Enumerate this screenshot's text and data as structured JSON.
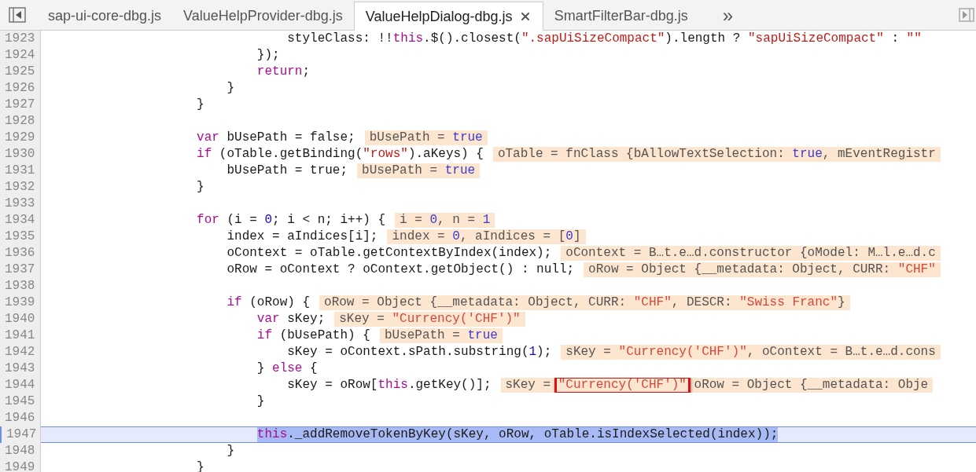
{
  "tabs": [
    {
      "label": "sap-ui-core-dbg.js",
      "selected": false
    },
    {
      "label": "ValueHelpProvider-dbg.js",
      "selected": false
    },
    {
      "label": "ValueHelpDialog-dbg.js",
      "selected": true
    },
    {
      "label": "SmartFilterBar-dbg.js",
      "selected": false
    }
  ],
  "more_tabs": "»",
  "lines": [
    {
      "n": "1923",
      "code": [
        {
          "t": "                                styleClass: !!",
          "kind": "plain"
        },
        {
          "t": "this",
          "kind": "keyword"
        },
        {
          "t": ".$().closest(",
          "kind": "plain"
        },
        {
          "t": "\".sapUiSizeCompact\"",
          "kind": "string"
        },
        {
          "t": ").length ? ",
          "kind": "plain"
        },
        {
          "t": "\"sapUiSizeCompact\"",
          "kind": "string"
        },
        {
          "t": " : ",
          "kind": "plain"
        },
        {
          "t": "\"\"",
          "kind": "string"
        }
      ]
    },
    {
      "n": "1924",
      "code": [
        {
          "t": "                            });",
          "kind": "plain"
        }
      ]
    },
    {
      "n": "1925",
      "code": [
        {
          "t": "                            return",
          "kind": "keyword"
        },
        {
          "t": ";",
          "kind": "plain"
        }
      ]
    },
    {
      "n": "1926",
      "code": [
        {
          "t": "                        }",
          "kind": "plain"
        }
      ]
    },
    {
      "n": "1927",
      "code": [
        {
          "t": "                    }",
          "kind": "plain"
        }
      ]
    },
    {
      "n": "1928"
    },
    {
      "n": "1929",
      "code": [
        {
          "t": "                    var",
          "kind": "keyword"
        },
        {
          "t": " bUsePath = false;",
          "kind": "plain"
        }
      ],
      "value": [
        {
          "t": "bUsePath = ",
          "kind": "plain"
        },
        {
          "t": "true",
          "kind": "literal"
        }
      ]
    },
    {
      "n": "1930",
      "code": [
        {
          "t": "                    if",
          "kind": "keyword"
        },
        {
          "t": " (oTable.getBinding(",
          "kind": "plain"
        },
        {
          "t": "\"rows\"",
          "kind": "string"
        },
        {
          "t": ").aKeys) {",
          "kind": "plain"
        }
      ],
      "value": [
        {
          "t": "oTable = fnClass {bAllowTextSelection: ",
          "kind": "plain"
        },
        {
          "t": "true",
          "kind": "literal"
        },
        {
          "t": ", mEventRegistr",
          "kind": "plain"
        }
      ]
    },
    {
      "n": "1931",
      "code": [
        {
          "t": "                        bUsePath = true;",
          "kind": "plain"
        }
      ],
      "value": [
        {
          "t": "bUsePath = ",
          "kind": "plain"
        },
        {
          "t": "true",
          "kind": "literal"
        }
      ]
    },
    {
      "n": "1932",
      "code": [
        {
          "t": "                    }",
          "kind": "plain"
        }
      ]
    },
    {
      "n": "1933"
    },
    {
      "n": "1934",
      "code": [
        {
          "t": "                    for",
          "kind": "keyword"
        },
        {
          "t": " (i = ",
          "kind": "plain"
        },
        {
          "t": "0",
          "kind": "literal"
        },
        {
          "t": "; i < n; i++) {",
          "kind": "plain"
        }
      ],
      "value": [
        {
          "t": "i = ",
          "kind": "plain"
        },
        {
          "t": "0",
          "kind": "literal"
        },
        {
          "t": ", n = ",
          "kind": "plain"
        },
        {
          "t": "1",
          "kind": "literal"
        }
      ]
    },
    {
      "n": "1935",
      "code": [
        {
          "t": "                        index = aIndices[i];",
          "kind": "plain"
        }
      ],
      "value": [
        {
          "t": "index = ",
          "kind": "plain"
        },
        {
          "t": "0",
          "kind": "literal"
        },
        {
          "t": ", aIndices = [",
          "kind": "plain"
        },
        {
          "t": "0",
          "kind": "literal"
        },
        {
          "t": "]",
          "kind": "plain"
        }
      ]
    },
    {
      "n": "1936",
      "code": [
        {
          "t": "                        oContext = oTable.getContextByIndex(index);",
          "kind": "plain"
        }
      ],
      "value": [
        {
          "t": "oContext = B…t.e…d.constructor {oModel: M…l.e…d.c",
          "kind": "plain"
        }
      ]
    },
    {
      "n": "1937",
      "code": [
        {
          "t": "                        oRow = oContext ? oContext.getObject() : null;",
          "kind": "plain"
        }
      ],
      "value": [
        {
          "t": "oRow = Object {__metadata: Object, CURR: ",
          "kind": "plain"
        },
        {
          "t": "\"CHF\"",
          "kind": "string"
        }
      ]
    },
    {
      "n": "1938"
    },
    {
      "n": "1939",
      "code": [
        {
          "t": "                        if",
          "kind": "keyword"
        },
        {
          "t": " (oRow) {",
          "kind": "plain"
        }
      ],
      "value": [
        {
          "t": "oRow = Object {__metadata: Object, CURR: ",
          "kind": "plain"
        },
        {
          "t": "\"CHF\"",
          "kind": "string"
        },
        {
          "t": ", DESCR: ",
          "kind": "plain"
        },
        {
          "t": "\"Swiss Franc\"",
          "kind": "string"
        },
        {
          "t": "}",
          "kind": "plain"
        }
      ]
    },
    {
      "n": "1940",
      "code": [
        {
          "t": "                            var",
          "kind": "keyword"
        },
        {
          "t": " sKey;",
          "kind": "plain"
        }
      ],
      "value": [
        {
          "t": "sKey = ",
          "kind": "plain"
        },
        {
          "t": "\"Currency('CHF')\"",
          "kind": "string"
        }
      ]
    },
    {
      "n": "1941",
      "code": [
        {
          "t": "                            if",
          "kind": "keyword"
        },
        {
          "t": " (bUsePath) {",
          "kind": "plain"
        }
      ],
      "value": [
        {
          "t": "bUsePath = ",
          "kind": "plain"
        },
        {
          "t": "true",
          "kind": "literal"
        }
      ]
    },
    {
      "n": "1942",
      "code": [
        {
          "t": "                                sKey = oContext.sPath.substring(",
          "kind": "plain"
        },
        {
          "t": "1",
          "kind": "literal"
        },
        {
          "t": ");",
          "kind": "plain"
        }
      ],
      "value": [
        {
          "t": "sKey = ",
          "kind": "plain"
        },
        {
          "t": "\"Currency('CHF')\"",
          "kind": "string"
        },
        {
          "t": ", oContext = B…t.e…d.cons",
          "kind": "plain"
        }
      ]
    },
    {
      "n": "1943",
      "code": [
        {
          "t": "                            } ",
          "kind": "plain"
        },
        {
          "t": "else",
          "kind": "keyword"
        },
        {
          "t": " {",
          "kind": "plain"
        }
      ]
    },
    {
      "n": "1944",
      "code": [
        {
          "t": "                                sKey = oRow[",
          "kind": "plain"
        },
        {
          "t": "this",
          "kind": "keyword"
        },
        {
          "t": ".getKey()];",
          "kind": "plain"
        }
      ],
      "value": [
        {
          "t": "sKey = ",
          "kind": "plain"
        },
        {
          "t": "\"Currency('CHF')\"",
          "kind": "string",
          "marked": true
        },
        {
          "t": " oRow = Object {__metadata: Obje",
          "kind": "plain"
        }
      ]
    },
    {
      "n": "1945",
      "code": [
        {
          "t": "                            }",
          "kind": "plain"
        }
      ]
    },
    {
      "n": "1946"
    },
    {
      "n": "1947",
      "current": true,
      "selected": true,
      "code": [
        {
          "t": "                            this",
          "kind": "keyword"
        },
        {
          "t": "._addRemoveTokenByKey(sKey, oRow, oTable.isIndexSelected(index));",
          "kind": "plain"
        }
      ]
    },
    {
      "n": "1948",
      "code": [
        {
          "t": "                        }",
          "kind": "plain"
        }
      ]
    },
    {
      "n": "1949",
      "code": [
        {
          "t": "                    }",
          "kind": "plain"
        }
      ]
    }
  ]
}
